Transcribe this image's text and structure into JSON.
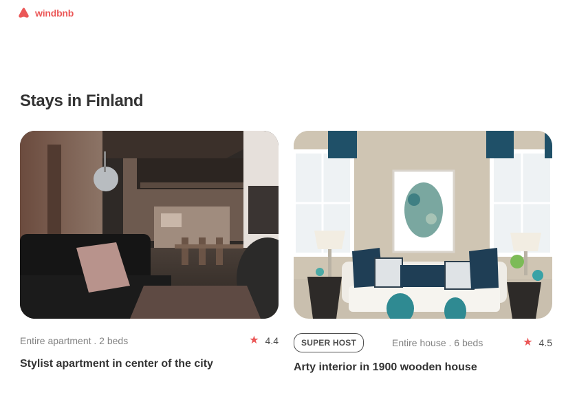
{
  "brand": {
    "name": "windbnb",
    "color": "#eb5757",
    "icon": "logo-icon"
  },
  "page": {
    "title": "Stays in Finland"
  },
  "stays": [
    {
      "superhost": false,
      "type": "Entire apartment",
      "beds": "2 beds",
      "type_line": "Entire apartment . 2 beds",
      "rating": "4.4",
      "title": "Stylist apartment in center of the city",
      "photo": "loft-apartment-interior"
    },
    {
      "superhost": true,
      "superhost_label": "SUPER HOST",
      "type": "Entire house",
      "beds": "6 beds",
      "type_line": "Entire house . 6 beds",
      "rating": "4.5",
      "title": "Arty interior in 1900 wooden house",
      "photo": "living-room-interior"
    }
  ],
  "icons": {
    "rating": "star-icon"
  },
  "colors": {
    "accent": "#eb5757",
    "text": "#333333",
    "muted": "#828282"
  }
}
